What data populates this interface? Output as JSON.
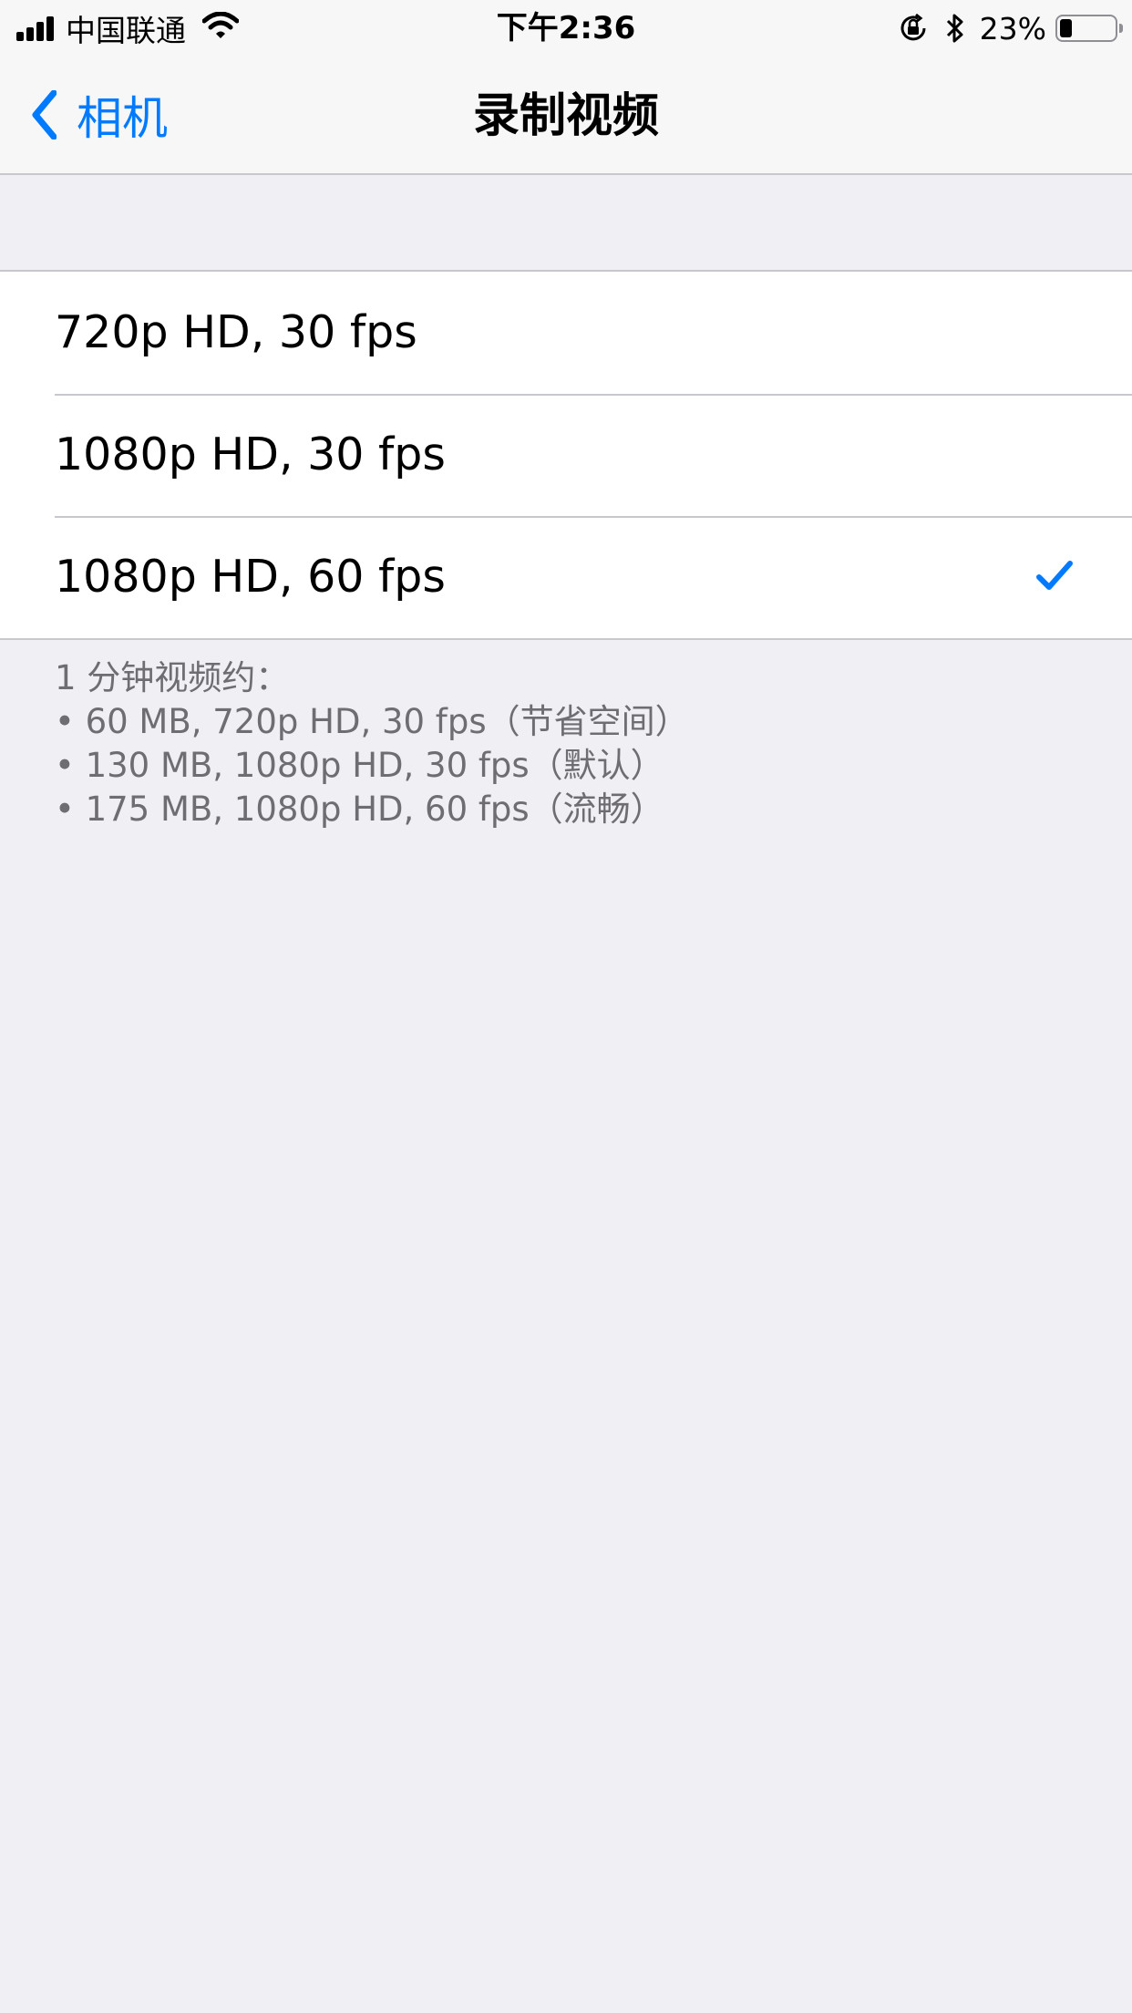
{
  "status_bar": {
    "carrier": "中国联通",
    "time": "下午2:36",
    "battery_percent": "23%",
    "battery_level": 0.23,
    "icons": [
      "signal-icon",
      "wifi-icon",
      "orientation-lock-icon",
      "bluetooth-icon",
      "battery-icon"
    ]
  },
  "nav": {
    "back_label": "相机",
    "title": "录制视频"
  },
  "options": [
    {
      "label": "720p HD, 30 fps",
      "selected": false
    },
    {
      "label": "1080p HD, 30 fps",
      "selected": false
    },
    {
      "label": "1080p HD, 60 fps",
      "selected": true
    }
  ],
  "footer": {
    "heading": "1 分钟视频约：",
    "lines": [
      "• 60 MB, 720p HD, 30 fps（节省空间）",
      "• 130 MB, 1080p HD, 30 fps（默认）",
      "• 175 MB, 1080p HD, 60 fps（流畅）"
    ]
  },
  "colors": {
    "accent": "#007aff",
    "background": "#efeff4",
    "separator": "#c8c7cc",
    "footer_text": "#6d6d72"
  }
}
